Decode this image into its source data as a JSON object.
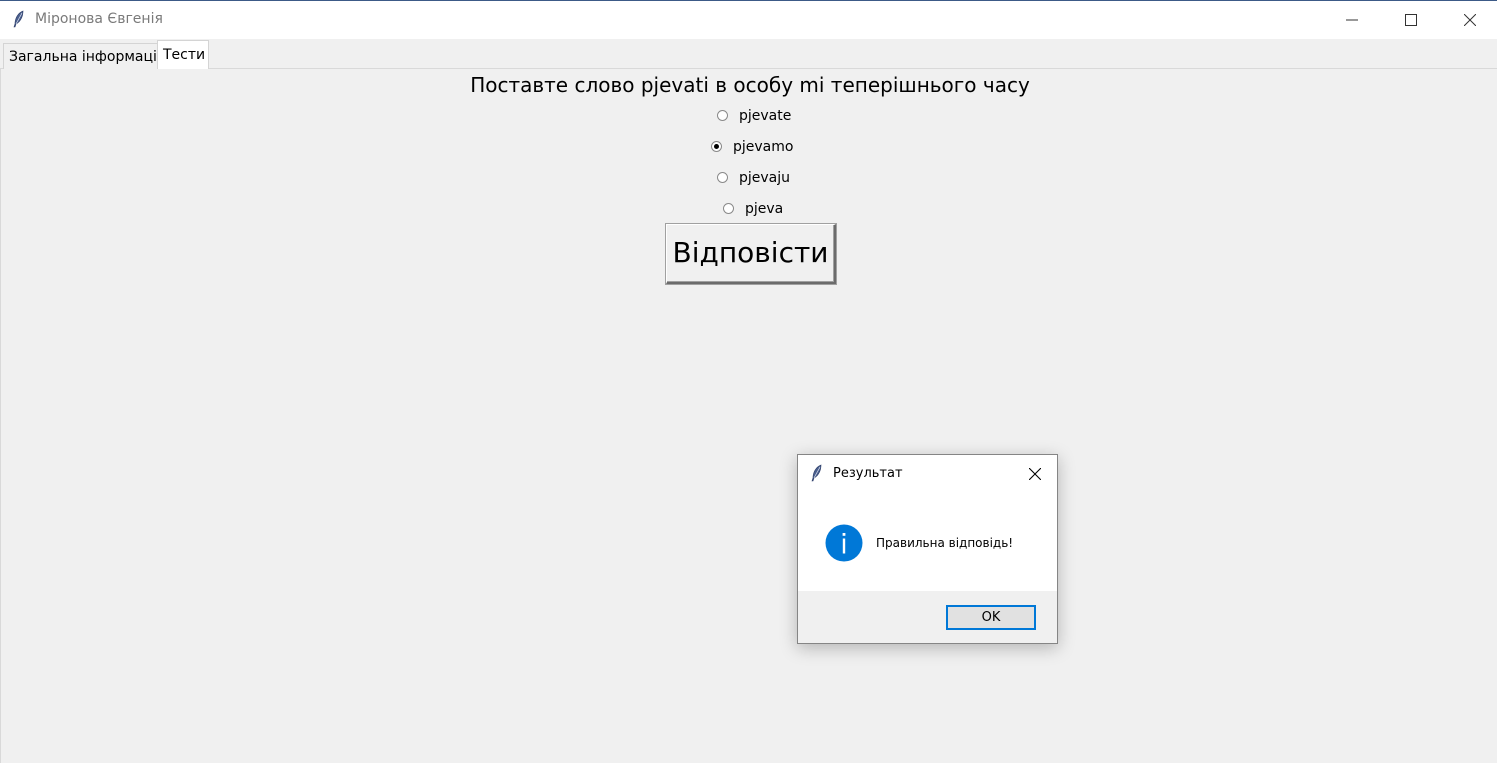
{
  "window": {
    "title": "Міронова Євгенія",
    "app_icon": "tk-feather-icon",
    "controls": [
      "minimize-icon",
      "maximize-icon",
      "close-icon"
    ]
  },
  "tabs": [
    {
      "label": "Загальна інформація",
      "active": false
    },
    {
      "label": "Тести",
      "active": true
    }
  ],
  "quiz": {
    "question": "Поставте слово pjevati в особу mi теперішнього часу",
    "options": [
      {
        "label": "pjevate",
        "selected": false
      },
      {
        "label": "pjevamo",
        "selected": true
      },
      {
        "label": "pjevaju",
        "selected": false
      },
      {
        "label": "pjeva",
        "selected": false
      }
    ],
    "answer_button": "Відповісти"
  },
  "dialog": {
    "title": "Результат",
    "icon": "info-icon",
    "message": "Правильна відповідь!",
    "ok_label": "OK",
    "accent": "#0078d7"
  },
  "colors": {
    "background": "#f0f0f0",
    "titlebar": "#ffffff",
    "accent": "#0078d7"
  }
}
